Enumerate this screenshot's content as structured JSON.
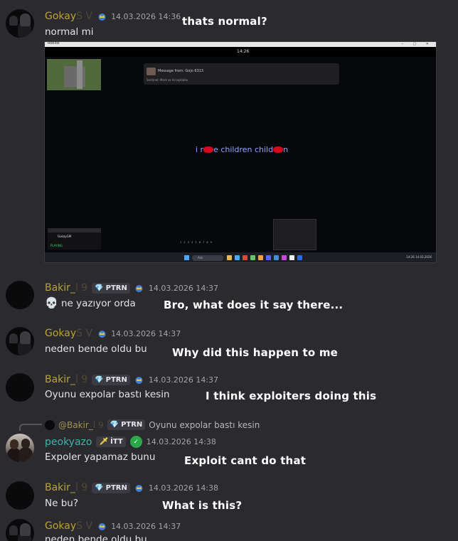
{
  "colors": {
    "background": "#2b2a2f",
    "username_gold": "#b9a33a",
    "username_teal": "#3cb6a5",
    "overlay_text": "#ffffff"
  },
  "messages": [
    {
      "author_visible": "Gokay",
      "author_faded": "S V",
      "timestamp": "14.03.2026 14:36",
      "text": "normal mi",
      "overlay": "thats normal?",
      "attachment": {
        "titlebar": "Roblox",
        "window_buttons": "– ▢ ✕",
        "clock": "14:26",
        "notification_title": "Message from: Gojo 6313",
        "notification_body": "Sentinel: Mark as Acceptable",
        "center_text_parts": [
          "i r",
          "e children child",
          "n"
        ],
        "hotbar": "1 2 3 4 5 6 7 8 9",
        "left_panel_label": "GokayGM",
        "left_panel_status": "PLAYING",
        "taskbar_search": "Ara",
        "tray_time": "14:26",
        "tray_date": "14.03.2026"
      }
    },
    {
      "author_visible": "Bakir_",
      "author_faded": "l 9",
      "tag": "PTRN",
      "timestamp": "14.03.2026 14:37",
      "emoji": "💀",
      "text": "ne yazıyor orda",
      "overlay": "Bro, what does it say there..."
    },
    {
      "author_visible": "Gokay",
      "author_faded": "S V",
      "timestamp": "14.03.2026 14:37",
      "text": "neden bende oldu bu",
      "overlay": "Why did this happen to me"
    },
    {
      "author_visible": "Bakir_",
      "author_faded": "l 9",
      "tag": "PTRN",
      "timestamp": "14.03.2026 14:37",
      "text": "Oyunu expolar bastı kesin",
      "overlay": "I think exploiters doing this"
    },
    {
      "reply_to_name": "@Bakir_",
      "reply_to_faded": "l 9",
      "reply_tag": "PTRN",
      "reply_text": "Oyunu expolar bastı kesin",
      "author_visible": "peokyazo",
      "tag": "İTT",
      "timestamp": "14.03.2026 14:38",
      "text": "Expoler yapamaz bunu",
      "overlay": "Exploit cant do that"
    },
    {
      "author_visible": "Bakir_",
      "author_faded": "l 9",
      "tag": "PTRN",
      "timestamp": "14.03.2026 14:38",
      "text": "Ne bu?",
      "overlay": "What is this?"
    },
    {
      "author_visible": "Gokay",
      "author_faded": "S V",
      "timestamp": "14.03.2026 14:37",
      "text": "neden bende oldu bu"
    }
  ]
}
